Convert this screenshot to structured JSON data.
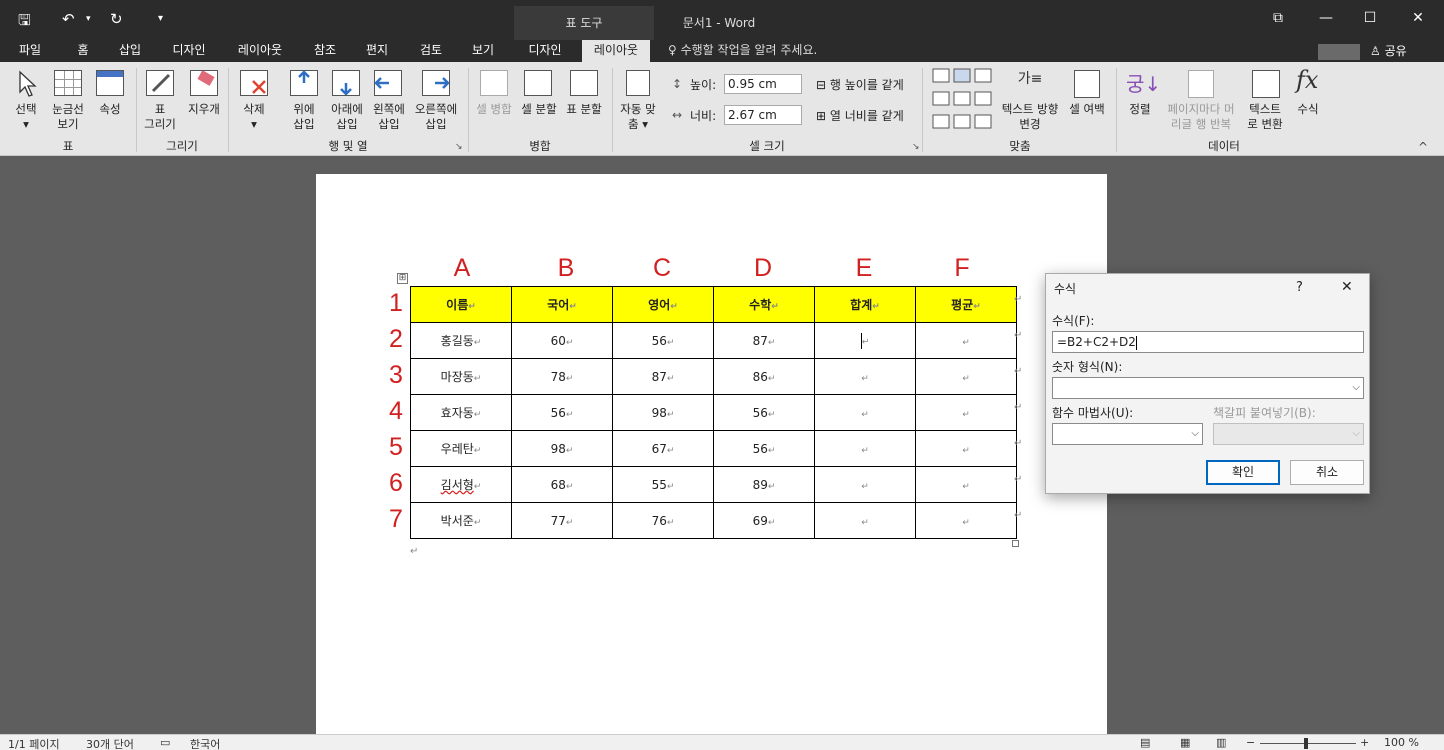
{
  "titlebar": {
    "context_label": "표 도구",
    "doc_title": "문서1 - Word",
    "qat": {
      "save": "🖫",
      "undo": "↶",
      "redo": "↻",
      "more": "▾"
    },
    "window": {
      "restore_ribbon": "⧉",
      "minimize": "—",
      "maximize": "☐",
      "close": "✕"
    }
  },
  "tabs": {
    "items": [
      "파일",
      "홈",
      "삽입",
      "디자인",
      "레이아웃",
      "참조",
      "편지",
      "검토",
      "보기",
      "디자인",
      "레이아웃"
    ],
    "active_index": 10,
    "tell_me": "♀ 수행할 작업을 알려 주세요.",
    "share": "♙ 공유"
  },
  "ribbon": {
    "groups": {
      "table": "표",
      "draw": "그리기",
      "rows_cols": "행 및 열",
      "merge": "병합",
      "cell_size": "셀 크기",
      "align": "맞춤",
      "data": "데이터"
    },
    "buttons": {
      "select": "선택",
      "select_caret": "▾",
      "gridlines_1": "눈금선",
      "gridlines_2": "보기",
      "properties": "속성",
      "draw_table_1": "표",
      "draw_table_2": "그리기",
      "eraser": "지우개",
      "delete": "삭제",
      "delete_caret": "▾",
      "insert_above_1": "위에",
      "insert_above_2": "삽입",
      "insert_below_1": "아래에",
      "insert_below_2": "삽입",
      "insert_left_1": "왼쪽에",
      "insert_left_2": "삽입",
      "insert_right_1": "오른쪽에",
      "insert_right_2": "삽입",
      "merge_cells": "셀 병합",
      "split_cells": "셀 분할",
      "split_table": "표 분할",
      "autofit_1": "자동 맞",
      "autofit_2": "춤 ▾",
      "height_label": "높이:",
      "height_value": "0.95 cm",
      "width_label": "너비:",
      "width_value": "2.67 cm",
      "distribute_rows": "행 높이를 같게",
      "distribute_cols": "열 너비를 같게",
      "text_direction_1": "텍스트 방향",
      "text_direction_2": "변경",
      "cell_margins": "셀 여백",
      "sort": "정렬",
      "repeat_header_1": "페이지마다 머",
      "repeat_header_2": "리글 행 반복",
      "convert_text_1": "텍스트",
      "convert_text_2": "로 변환",
      "formula": "수식",
      "collapse": "^"
    }
  },
  "document": {
    "column_letters": [
      "A",
      "B",
      "C",
      "D",
      "E",
      "F"
    ],
    "row_numbers": [
      "1",
      "2",
      "3",
      "4",
      "5",
      "6",
      "7"
    ],
    "table_header": [
      "이름",
      "국어",
      "영어",
      "수학",
      "합계",
      "평균"
    ],
    "table_rows": [
      [
        "홍길동",
        "60",
        "56",
        "87",
        "",
        ""
      ],
      [
        "마장동",
        "78",
        "87",
        "86",
        "",
        ""
      ],
      [
        "효자동",
        "56",
        "98",
        "56",
        "",
        ""
      ],
      [
        "우레탄",
        "98",
        "67",
        "56",
        "",
        ""
      ],
      [
        "김서형",
        "68",
        "55",
        "89",
        "",
        ""
      ],
      [
        "박서준",
        "77",
        "76",
        "69",
        "",
        ""
      ]
    ],
    "cell_mark": "↵",
    "move_handle": "⊞"
  },
  "dialog": {
    "title": "수식",
    "help": "?",
    "close": "✕",
    "formula_label": "수식(F):",
    "formula_value": "=B2+C2+D2",
    "number_format_label": "숫자 형식(N):",
    "number_format_value": "",
    "paste_function_label": "함수 마법사(U):",
    "paste_function_value": "",
    "paste_bookmark_label": "책갈피 붙여넣기(B):",
    "paste_bookmark_value": "",
    "ok": "확인",
    "cancel": "취소"
  },
  "statusbar": {
    "page": "1/1 페이지",
    "words": "30개 단어",
    "language": "한국어",
    "zoom": "100 %"
  }
}
